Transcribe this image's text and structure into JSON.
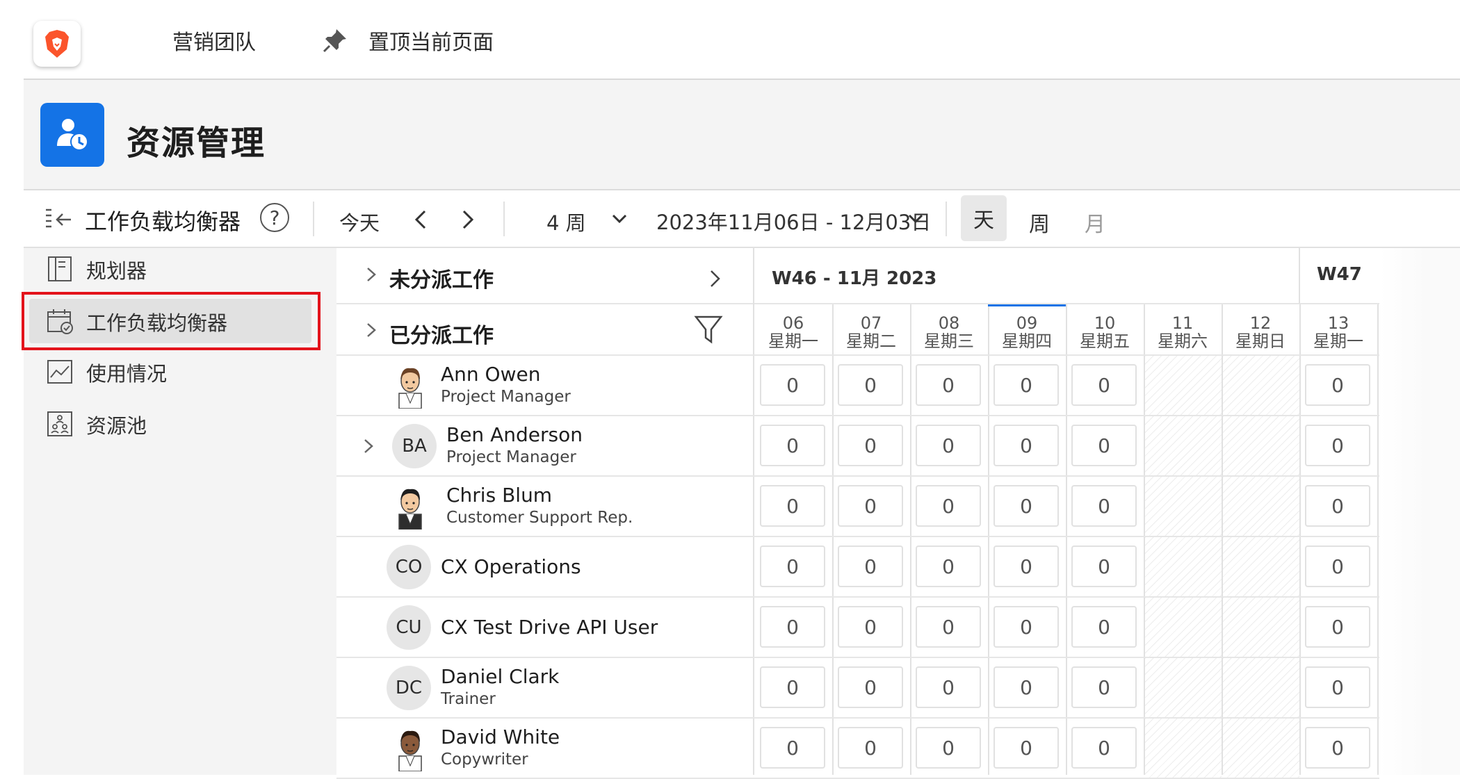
{
  "topbar": {
    "team": "营销团队",
    "pin_label": "置顶当前页面"
  },
  "header": {
    "title": "资源管理"
  },
  "toolbar": {
    "title": "工作负载均衡器",
    "help": "?",
    "today": "今天",
    "weeks": "4 周",
    "date_range": "2023年11月06日 - 12月03日",
    "view_day": "天",
    "view_week": "周",
    "view_month": "月"
  },
  "sidebar": {
    "items": [
      {
        "label": "规划器",
        "icon": "planner-icon"
      },
      {
        "label": "工作负载均衡器",
        "icon": "calendar-check-icon",
        "selected": true
      },
      {
        "label": "使用情况",
        "icon": "chart-line-icon"
      },
      {
        "label": "资源池",
        "icon": "resource-pool-icon"
      }
    ]
  },
  "grid": {
    "unassigned": "未分派工作",
    "assigned": "已分派工作",
    "weeks": [
      "W46 - 11月 2023",
      "W47"
    ],
    "days": [
      {
        "num": "06",
        "name": "星期一"
      },
      {
        "num": "07",
        "name": "星期二"
      },
      {
        "num": "08",
        "name": "星期三"
      },
      {
        "num": "09",
        "name": "星期四",
        "today": true
      },
      {
        "num": "10",
        "name": "星期五"
      },
      {
        "num": "11",
        "name": "星期六",
        "weekend": true
      },
      {
        "num": "12",
        "name": "星期日",
        "weekend": true
      },
      {
        "num": "13",
        "name": "星期一"
      }
    ],
    "people": [
      {
        "name": "Ann Owen",
        "role": "Project Manager",
        "avatar": "photo",
        "values": [
          "0",
          "0",
          "0",
          "0",
          "0",
          "0"
        ]
      },
      {
        "name": "Ben Anderson",
        "role": "Project Manager",
        "initials": "BA",
        "expandable": true,
        "values": [
          "0",
          "0",
          "0",
          "0",
          "0",
          "0"
        ]
      },
      {
        "name": "Chris Blum",
        "role": "Customer Support Rep.",
        "avatar": "photo",
        "values": [
          "0",
          "0",
          "0",
          "0",
          "0",
          "0"
        ]
      },
      {
        "name": "CX Operations",
        "role": "",
        "initials": "CO",
        "values": [
          "0",
          "0",
          "0",
          "0",
          "0",
          "0"
        ]
      },
      {
        "name": "CX Test Drive API User",
        "role": "",
        "initials": "CU",
        "values": [
          "0",
          "0",
          "0",
          "0",
          "0",
          "0"
        ]
      },
      {
        "name": "Daniel Clark",
        "role": "Trainer",
        "initials": "DC",
        "values": [
          "0",
          "0",
          "0",
          "0",
          "0",
          "0"
        ]
      },
      {
        "name": "David White",
        "role": "Copywriter",
        "avatar": "photo",
        "values": [
          "0",
          "0",
          "0",
          "0",
          "0",
          "0"
        ]
      }
    ]
  }
}
